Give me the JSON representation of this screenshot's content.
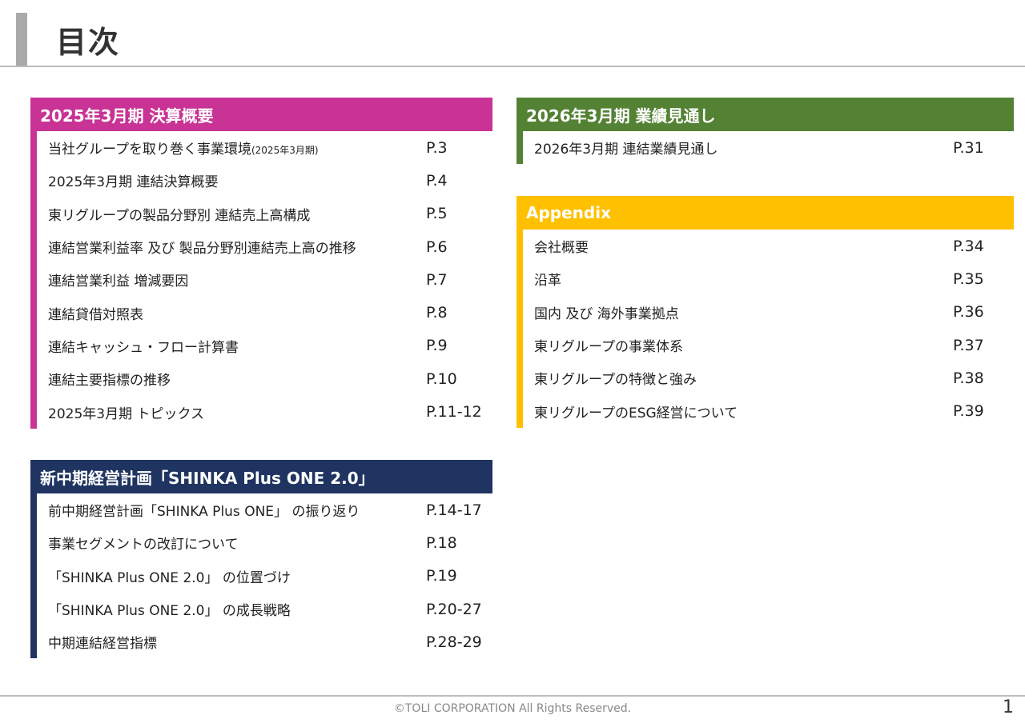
{
  "page": {
    "title": "目次"
  },
  "sections": {
    "kessan": {
      "title": "2025年3月期 決算概要",
      "color": "#c83395",
      "items": [
        {
          "label": "当社グループを取り巻く事業環境",
          "note": "(2025年3月期)",
          "page": "P.3"
        },
        {
          "label": "2025年3月期 連結決算概要",
          "note": "",
          "page": "P.4"
        },
        {
          "label": "東リグループの製品分野別 連結売上高構成",
          "note": "",
          "page": "P.5"
        },
        {
          "label": "連結営業利益率 及び 製品分野別連結売上高の推移",
          "note": "",
          "page": "P.6"
        },
        {
          "label": "連結営業利益 増減要因",
          "note": "",
          "page": "P.7"
        },
        {
          "label": "連結貸借対照表",
          "note": "",
          "page": "P.8"
        },
        {
          "label": "連結キャッシュ・フロー計算書",
          "note": "",
          "page": "P.9"
        },
        {
          "label": "連結主要指標の推移",
          "note": "",
          "page": "P.10"
        },
        {
          "label": "2025年3月期 トピックス",
          "note": "",
          "page": "P.11-12"
        }
      ]
    },
    "chuki": {
      "title": "新中期経営計画「SHINKA Plus ONE 2.0」",
      "color": "#1f3460",
      "items": [
        {
          "label": "前中期経営計画「SHINKA Plus ONE」 の振り返り",
          "page": "P.14-17"
        },
        {
          "label": "事業セグメントの改訂について",
          "page": "P.18"
        },
        {
          "label": "「SHINKA Plus ONE 2.0」 の位置づけ",
          "page": "P.19"
        },
        {
          "label": "「SHINKA Plus ONE 2.0」 の成長戦略",
          "page": "P.20-27"
        },
        {
          "label": "中期連結経営指標",
          "page": "P.28-29"
        }
      ]
    },
    "gyoseki": {
      "title": "2026年3月期 業績見通し",
      "color": "#548235",
      "items": [
        {
          "label": "2026年3月期 連結業績見通し",
          "page": "P.31"
        }
      ]
    },
    "appendix": {
      "title": "Appendix",
      "color": "#ffc000",
      "items": [
        {
          "label": "会社概要",
          "page": "P.34"
        },
        {
          "label": "沿革",
          "page": "P.35"
        },
        {
          "label": "国内 及び 海外事業拠点",
          "page": "P.36"
        },
        {
          "label": "東リグループの事業体系",
          "page": "P.37"
        },
        {
          "label": "東リグループの特徴と強み",
          "page": "P.38"
        },
        {
          "label": "東リグループのESG経営について",
          "page": "P.39"
        }
      ]
    }
  },
  "footer": {
    "copyright": "©TOLI CORPORATION All Rights Reserved.",
    "page_number": "1"
  }
}
